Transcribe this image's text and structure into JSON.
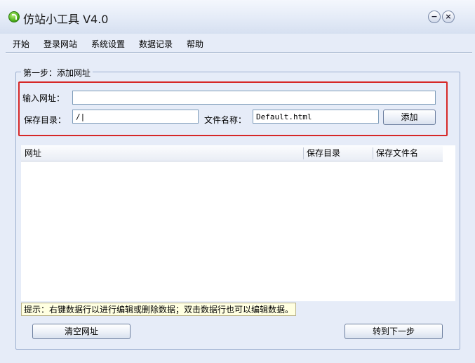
{
  "window": {
    "title": "仿站小工具 V4.0"
  },
  "menu": [
    {
      "label": "开始"
    },
    {
      "label": "登录网站"
    },
    {
      "label": "系统设置"
    },
    {
      "label": "数据记录"
    },
    {
      "label": "帮助"
    }
  ],
  "step": {
    "legend": "第一步：添加网址",
    "url_label": "输入网址：",
    "url_value": "",
    "dir_label": "保存目录：",
    "dir_value": "/|",
    "file_label": "文件名称：",
    "file_value": "Default.html",
    "add_button": "添加"
  },
  "table": {
    "columns": [
      "网址",
      "保存目录",
      "保存文件名"
    ],
    "rows": []
  },
  "tip": "提示：右键数据行以进行编辑或删除数据；双击数据行也可以编辑数据。",
  "buttons": {
    "clear": "清空网址",
    "next": "转到下一步"
  }
}
